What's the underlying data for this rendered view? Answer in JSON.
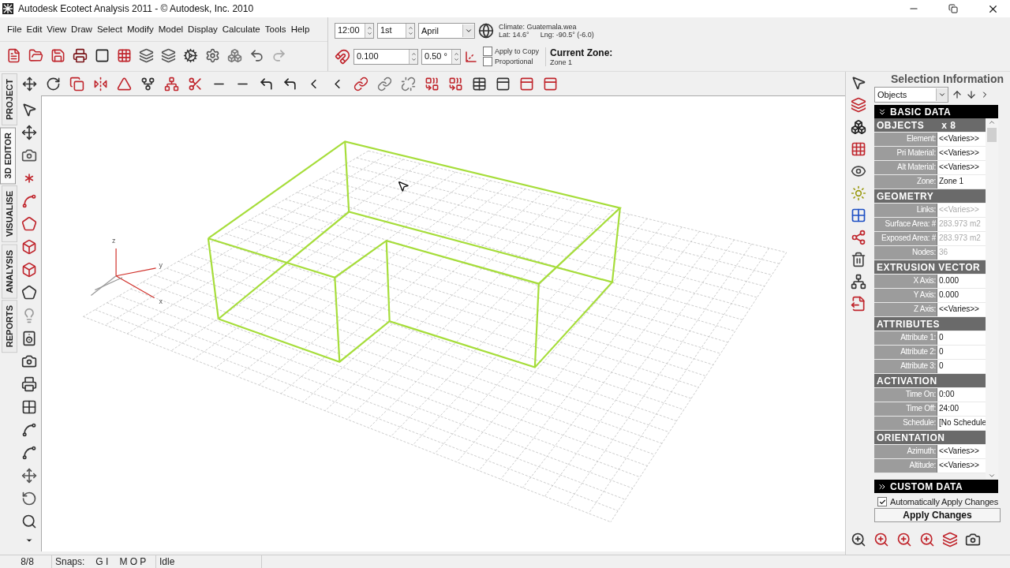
{
  "window": {
    "title": "Autodesk Ecotect Analysis 2011 - © Autodesk, Inc. 2010"
  },
  "menu": [
    {
      "label": "File"
    },
    {
      "label": "Edit"
    },
    {
      "label": "View"
    },
    {
      "label": "Draw"
    },
    {
      "label": "Select"
    },
    {
      "label": "Modify"
    },
    {
      "label": "Model"
    },
    {
      "label": "Display"
    },
    {
      "label": "Calculate"
    },
    {
      "label": "Tools"
    },
    {
      "label": "Help"
    }
  ],
  "time_controls": {
    "time": "12:00",
    "day": "1st",
    "month": "April"
  },
  "climate": {
    "file": "Climate: Guatemala.wea",
    "lat": "Lat: 14.6°",
    "lng": "Lng: -90.5° (-6.0)"
  },
  "snap_controls": {
    "increment": "0.100",
    "angle": "0.50 °",
    "apply_to_copy": {
      "label": "Apply to Copy",
      "checked": false
    },
    "proportional": {
      "label": "Proportional",
      "checked": false
    }
  },
  "current_zone": {
    "label": "Current Zone:",
    "value": "Zone 1"
  },
  "side_tabs": [
    {
      "label": "PROJECT",
      "selected": false
    },
    {
      "label": "3D EDITOR",
      "selected": true
    },
    {
      "label": "VISUALISE",
      "selected": false
    },
    {
      "label": "ANALYSIS",
      "selected": false
    },
    {
      "label": "REPORTS",
      "selected": false
    }
  ],
  "viewport": {
    "axes": {
      "z": "z",
      "y": "y",
      "x": "x"
    }
  },
  "selection_panel": {
    "title": "Selection Information",
    "filter": "Objects",
    "basic_data": {
      "title": "BASIC DATA",
      "expanded": true
    },
    "properties": [
      {
        "kind": "group",
        "label": "OBJECTS",
        "value": "x 8"
      },
      {
        "kind": "field",
        "label": "Element:",
        "value": "<<Varies>>",
        "disabled": false
      },
      {
        "kind": "field",
        "label": "Pri Material:",
        "value": "<<Varies>>",
        "disabled": false
      },
      {
        "kind": "field",
        "label": "Alt Material:",
        "value": "<<Varies>>",
        "disabled": false
      },
      {
        "kind": "field",
        "label": "Zone:",
        "value": "Zone 1",
        "disabled": false
      },
      {
        "kind": "group",
        "label": "GEOMETRY"
      },
      {
        "kind": "field",
        "label": "Links:",
        "value": "<<Varies>>",
        "disabled": true
      },
      {
        "kind": "field",
        "label": "Surface Area: #",
        "value": "283.973 m2",
        "disabled": true
      },
      {
        "kind": "field",
        "label": "Exposed Area: #",
        "value": "283.973 m2",
        "disabled": true
      },
      {
        "kind": "field",
        "label": "Nodes:",
        "value": "36",
        "disabled": true
      },
      {
        "kind": "group",
        "label": "EXTRUSION VECTOR"
      },
      {
        "kind": "field",
        "label": "X Axis:",
        "value": "0.000",
        "disabled": false
      },
      {
        "kind": "field",
        "label": "Y Axis:",
        "value": "0.000",
        "disabled": false
      },
      {
        "kind": "field",
        "label": "Z Axis:",
        "value": "<<Varies>>",
        "disabled": false
      },
      {
        "kind": "group",
        "label": "ATTRIBUTES"
      },
      {
        "kind": "field",
        "label": "Attribute 1:",
        "value": "0",
        "disabled": false
      },
      {
        "kind": "field",
        "label": "Attribute 2:",
        "value": "0",
        "disabled": false
      },
      {
        "kind": "field",
        "label": "Attribute 3:",
        "value": "0",
        "disabled": false
      },
      {
        "kind": "group",
        "label": "ACTIVATION"
      },
      {
        "kind": "field",
        "label": "Time On:",
        "value": "0:00",
        "disabled": false
      },
      {
        "kind": "field",
        "label": "Time Off:",
        "value": "24:00",
        "disabled": false
      },
      {
        "kind": "field",
        "label": "Schedule:",
        "value": "[No Schedule",
        "disabled": false
      },
      {
        "kind": "group",
        "label": "ORIENTATION"
      },
      {
        "kind": "field",
        "label": "Azimuth:",
        "value": "<<Varies>>",
        "disabled": false
      },
      {
        "kind": "field",
        "label": "Altitude:",
        "value": "<<Varies>>",
        "disabled": false
      }
    ],
    "custom_data": {
      "title": "CUSTOM DATA",
      "expanded": false
    },
    "auto_apply": {
      "label": "Automatically Apply Changes",
      "checked": true
    },
    "apply_button": "Apply Changes"
  },
  "status_bar": {
    "selection": "8/8",
    "snaps_label": "Snaps:",
    "snaps_group_1": "G I",
    "snaps_group_2": "M O P",
    "state": "Idle"
  }
}
